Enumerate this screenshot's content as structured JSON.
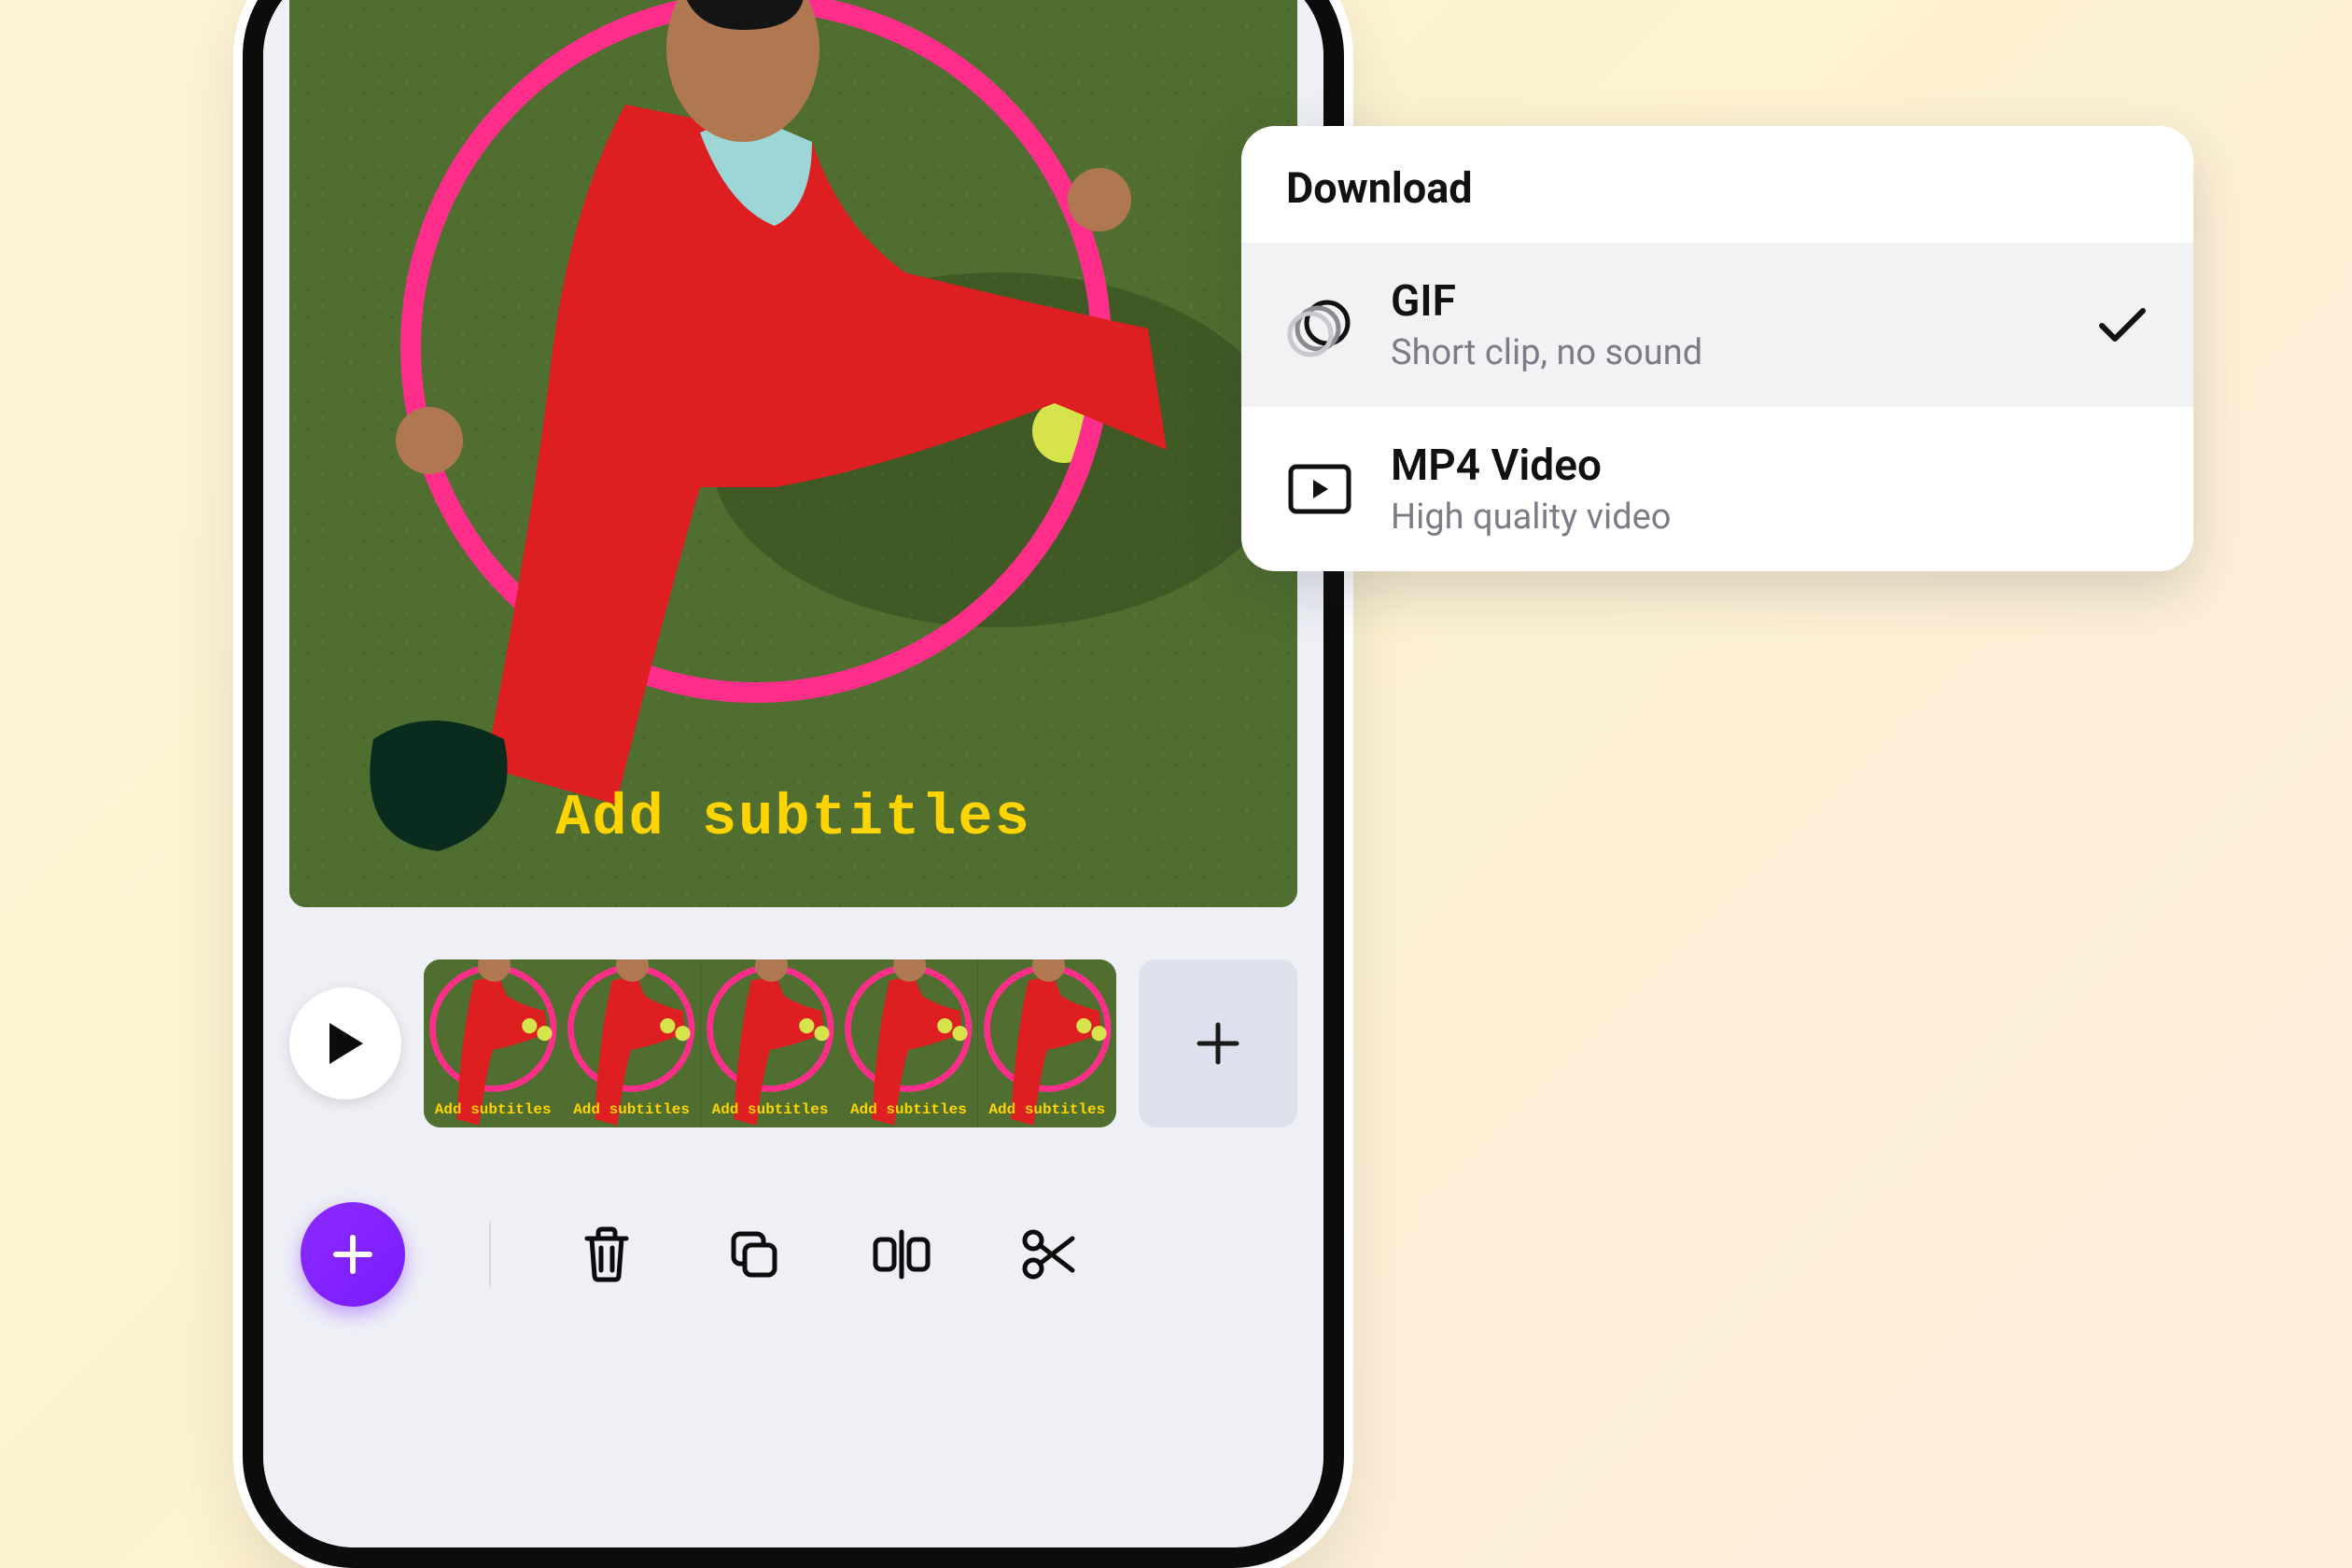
{
  "canvas": {
    "subtitle_text": "Add subtitles"
  },
  "timeline": {
    "frame_subtitle": "Add subtitles",
    "frame_count": 5
  },
  "toolbar": {
    "add_label": "Add",
    "delete_label": "Delete",
    "duplicate_label": "Duplicate",
    "split_label": "Split",
    "cut_label": "Cut"
  },
  "download_popover": {
    "header": "Download",
    "options": [
      {
        "id": "gif",
        "title": "GIF",
        "desc": "Short clip, no sound",
        "selected": true,
        "icon": "gif-icon"
      },
      {
        "id": "mp4",
        "title": "MP4 Video",
        "desc": "High quality video",
        "selected": false,
        "icon": "video-icon"
      }
    ]
  }
}
